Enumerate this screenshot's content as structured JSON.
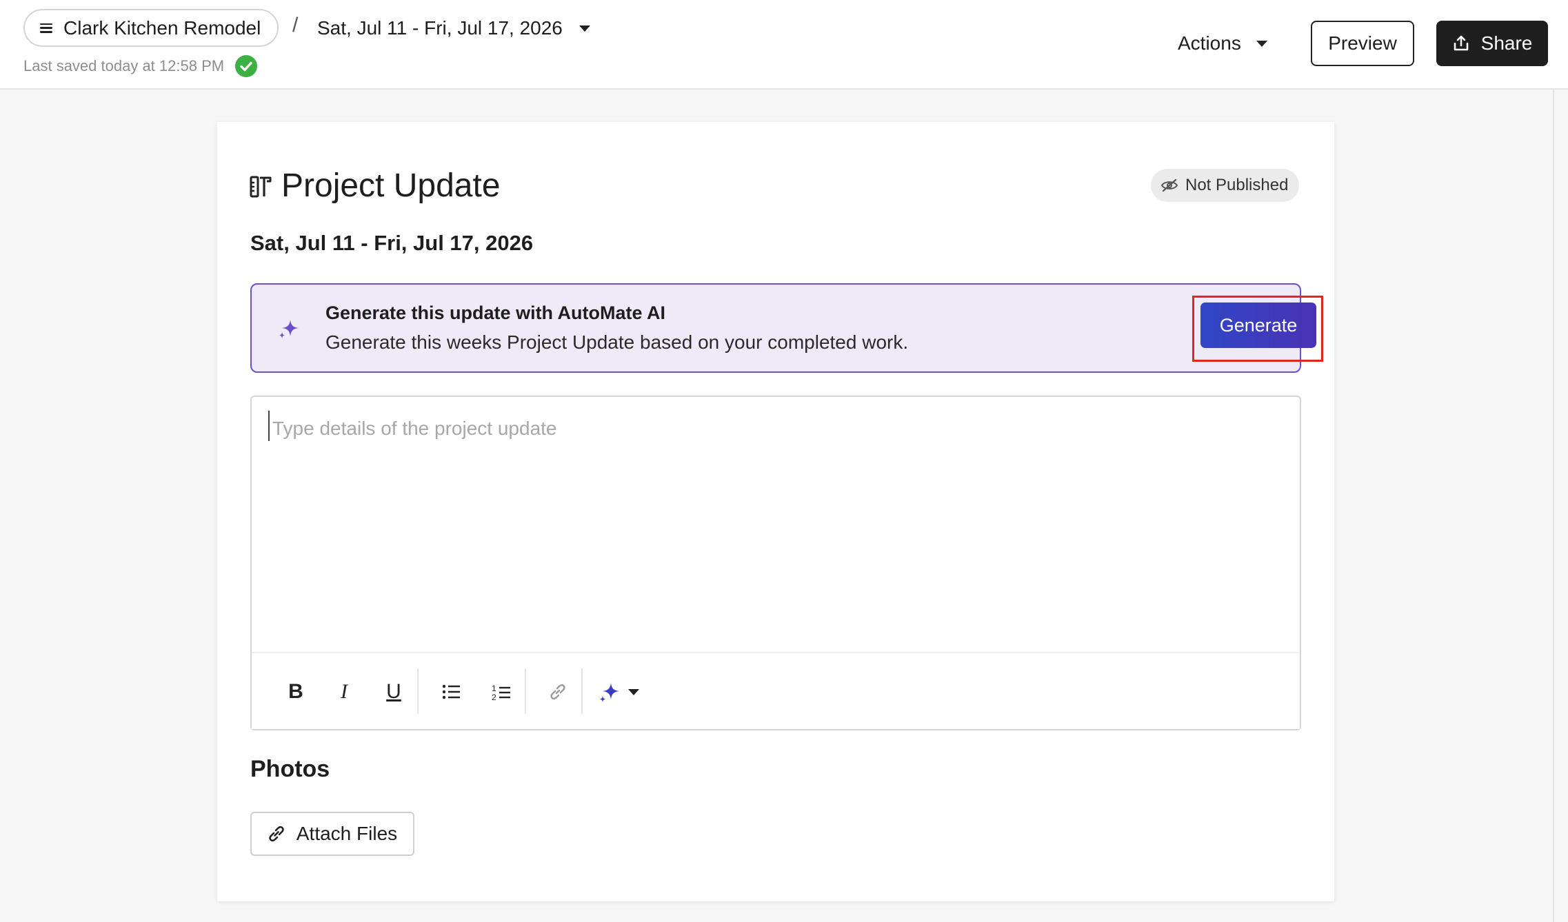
{
  "header": {
    "project_name": "Clark Kitchen Remodel",
    "separator": "/",
    "date_range": "Sat, Jul 11 - Fri, Jul 17, 2026",
    "saved_status": "Last saved today at 12:58 PM",
    "actions_label": "Actions",
    "preview_label": "Preview",
    "share_label": "Share"
  },
  "card": {
    "title": "Project Update",
    "status_badge": "Not Published",
    "date_heading": "Sat, Jul 11 - Fri, Jul 17, 2026"
  },
  "ai_banner": {
    "title": "Generate this update with AutoMate AI",
    "description": "Generate this weeks Project Update based on your completed work.",
    "button_label": "Generate"
  },
  "editor": {
    "value": "",
    "placeholder": "Type details of the project update",
    "toolbar": {
      "bold": "B",
      "italic": "I",
      "underline": "U"
    }
  },
  "photos": {
    "title": "Photos",
    "attach_label": "Attach Files"
  },
  "colors": {
    "accent_purple": "#6b4fd0",
    "banner_bg": "#efeaf8",
    "generate_btn": "#3a3dc0",
    "highlight_red": "#e0281c",
    "saved_green": "#3cb043",
    "share_bg": "#1f1f1f"
  },
  "icons": {
    "menu": "hamburger-icon",
    "date_caret": "caret-down-icon",
    "saved": "check-circle-icon",
    "share": "share-upload-icon",
    "title": "tools-icon",
    "badge": "eye-off-icon",
    "ai": "sparkles-icon",
    "attach": "paperclip-link-icon"
  }
}
